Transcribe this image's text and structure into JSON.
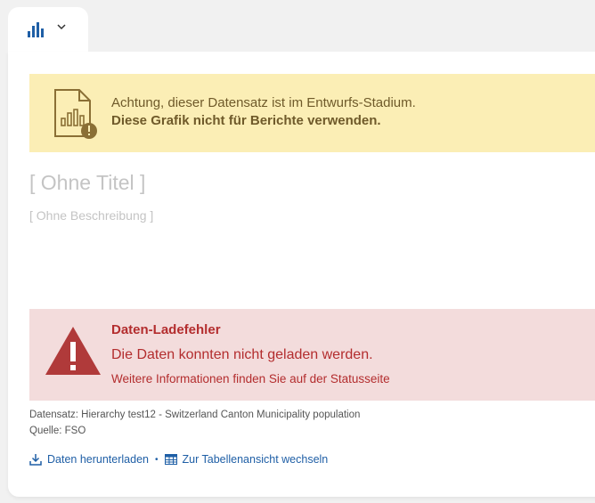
{
  "tab": {
    "icon": "bar-chart-icon",
    "dropdown_icon": "chevron-down-icon"
  },
  "warning": {
    "icon": "document-chart-warning-icon",
    "message": "Achtung, dieser Datensatz ist im Entwurfs-Stadium.",
    "message_bold": "Diese Grafik nicht für Berichte verwenden.",
    "background": "#fbeeb5",
    "text_color": "#6f5a2a"
  },
  "chart": {
    "title": "[ Ohne Titel ]",
    "description": "[ Ohne Beschreibung ]"
  },
  "error": {
    "icon": "warning-triangle-icon",
    "title": "Daten-Ladefehler",
    "message": "Die Daten konnten nicht geladen werden.",
    "more_info": "Weitere Informationen finden Sie auf der Statusseite",
    "background": "#f3dcdc",
    "text_color": "#b32d2e"
  },
  "footer": {
    "dataset": "Datensatz: Hierarchy test12 - Switzerland Canton Municipality population",
    "source": "Quelle: FSO",
    "download_label": "Daten herunterladen",
    "download_icon": "download-icon",
    "separator": "•",
    "table_label": "Zur Tabellenansicht wechseln",
    "table_icon": "table-icon",
    "link_color": "#1f5fa6"
  }
}
